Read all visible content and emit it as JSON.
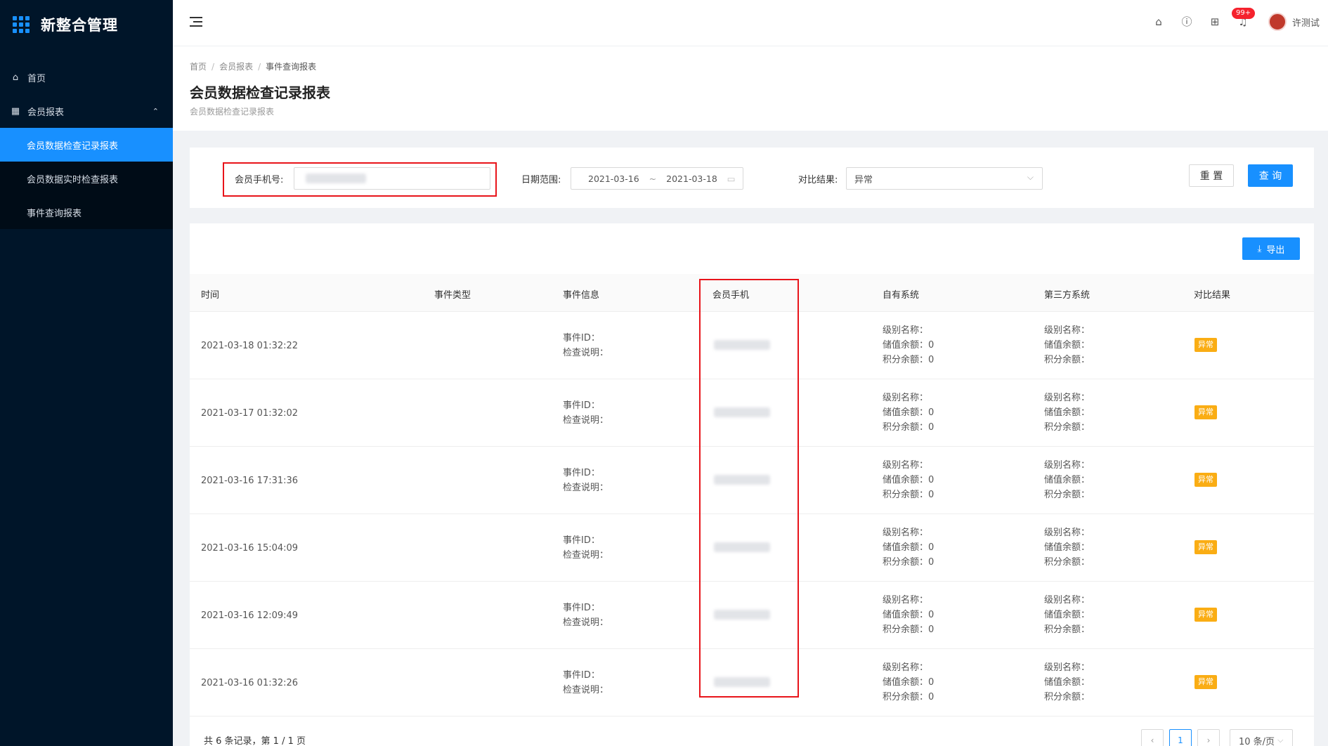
{
  "app": {
    "title": "新整合管理"
  },
  "sidebar": {
    "items": [
      {
        "label": "首页",
        "icon": "home-icon"
      },
      {
        "label": "会员报表",
        "icon": "table-icon",
        "expanded": true
      }
    ],
    "submenu": [
      {
        "label": "会员数据检查记录报表",
        "active": true
      },
      {
        "label": "会员数据实时检查报表",
        "active": false
      },
      {
        "label": "事件查询报表",
        "active": false
      }
    ]
  },
  "header": {
    "badge": "99+",
    "user": "许测试"
  },
  "breadcrumb": [
    "首页",
    "会员报表",
    "事件查询报表"
  ],
  "page": {
    "title": "会员数据检查记录报表",
    "subtitle": "会员数据检查记录报表"
  },
  "filters": {
    "phone_label": "会员手机号:",
    "date_label": "日期范围:",
    "date_start": "2021-03-16",
    "date_sep": "~",
    "date_end": "2021-03-18",
    "result_label": "对比结果:",
    "result_value": "异常",
    "reset_label": "重 置",
    "query_label": "查 询"
  },
  "export_label": "导出",
  "table": {
    "columns": [
      "时间",
      "事件类型",
      "事件信息",
      "会员手机",
      "自有系统",
      "第三方系统",
      "对比结果"
    ],
    "event_id_label": "事件ID：",
    "check_desc_label": "检查说明：",
    "own_lines": [
      "级别名称：",
      "储值余额：0",
      "积分余额：0"
    ],
    "third_lines": [
      "级别名称：",
      "储值余额：",
      "积分余额："
    ],
    "rows": [
      {
        "time": "2021-03-18 01:32:22",
        "result": "异常"
      },
      {
        "time": "2021-03-17 01:32:02",
        "result": "异常"
      },
      {
        "time": "2021-03-16 17:31:36",
        "result": "异常"
      },
      {
        "time": "2021-03-16 15:04:09",
        "result": "异常"
      },
      {
        "time": "2021-03-16 12:09:49",
        "result": "异常"
      },
      {
        "time": "2021-03-16 01:32:26",
        "result": "异常"
      }
    ]
  },
  "footer": {
    "summary": "共 6 条记录，第 1 / 1 页",
    "current_page": "1",
    "page_size": "10 条/页"
  },
  "colors": {
    "primary": "#1890ff",
    "sidebar_bg": "#001529",
    "warn_tag": "#faad14",
    "highlight": "#e8141a"
  }
}
